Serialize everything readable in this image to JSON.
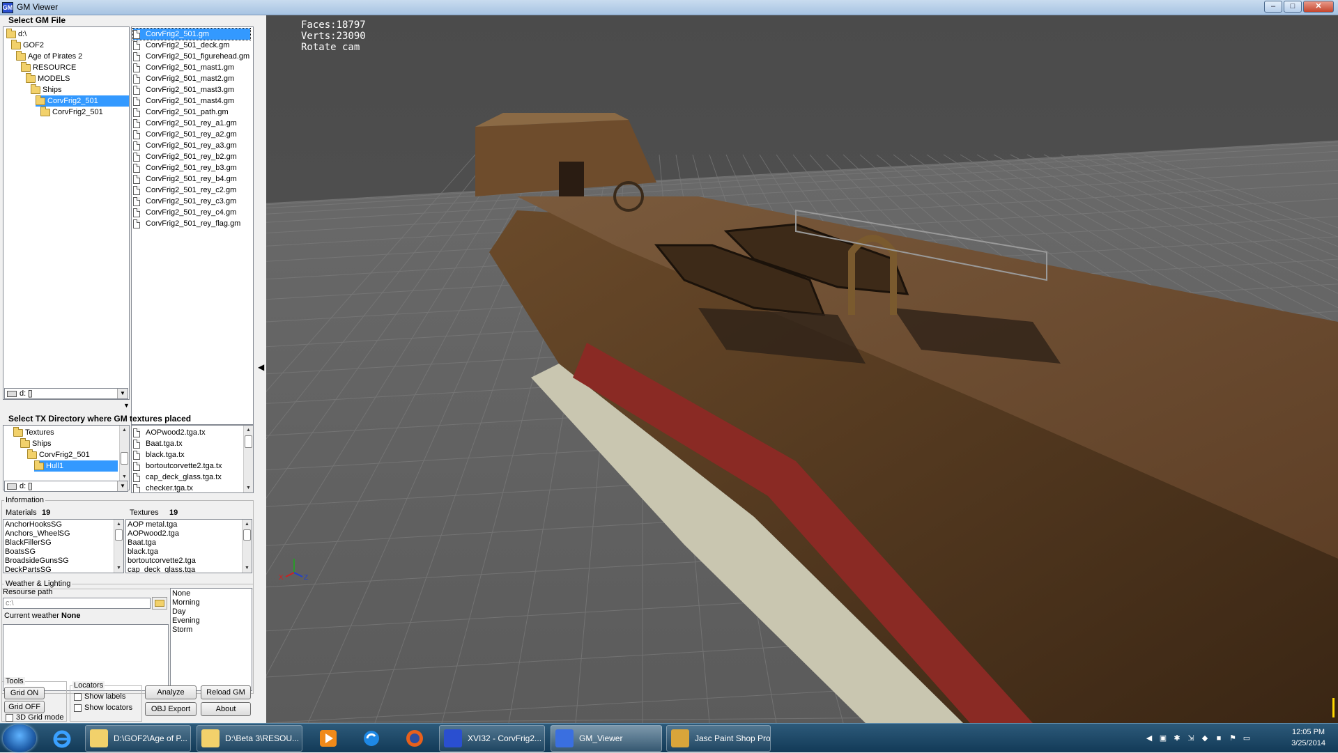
{
  "window": {
    "title": "GM Viewer"
  },
  "gm_section": {
    "label": "Select GM File",
    "tree": [
      {
        "label": "d:\\",
        "indent": 0,
        "selected": false
      },
      {
        "label": "GOF2",
        "indent": 1,
        "selected": false
      },
      {
        "label": "Age of Pirates 2",
        "indent": 2,
        "selected": false
      },
      {
        "label": "RESOURCE",
        "indent": 3,
        "selected": false
      },
      {
        "label": "MODELS",
        "indent": 4,
        "selected": false
      },
      {
        "label": "Ships",
        "indent": 5,
        "selected": false
      },
      {
        "label": "CorvFrig2_501",
        "indent": 6,
        "selected": true
      },
      {
        "label": "CorvFrig2_501",
        "indent": 7,
        "selected": false
      }
    ],
    "drive_combo": "d: []",
    "files": [
      "CorvFrig2_501.gm",
      "CorvFrig2_501_deck.gm",
      "CorvFrig2_501_figurehead.gm",
      "CorvFrig2_501_mast1.gm",
      "CorvFrig2_501_mast2.gm",
      "CorvFrig2_501_mast3.gm",
      "CorvFrig2_501_mast4.gm",
      "CorvFrig2_501_path.gm",
      "CorvFrig2_501_rey_a1.gm",
      "CorvFrig2_501_rey_a2.gm",
      "CorvFrig2_501_rey_a3.gm",
      "CorvFrig2_501_rey_b2.gm",
      "CorvFrig2_501_rey_b3.gm",
      "CorvFrig2_501_rey_b4.gm",
      "CorvFrig2_501_rey_c2.gm",
      "CorvFrig2_501_rey_c3.gm",
      "CorvFrig2_501_rey_c4.gm",
      "CorvFrig2_501_rey_flag.gm"
    ],
    "selected_file": 0
  },
  "tx_section": {
    "label": "Select TX Directory where GM textures placed",
    "tree": [
      {
        "label": "Textures",
        "indent": 1,
        "selected": false
      },
      {
        "label": "Ships",
        "indent": 2,
        "selected": false
      },
      {
        "label": "CorvFrig2_501",
        "indent": 3,
        "selected": false
      },
      {
        "label": "Hull1",
        "indent": 4,
        "selected": true
      }
    ],
    "drive_combo": "d: []",
    "files": [
      "AOPwood2.tga.tx",
      "Baat.tga.tx",
      "black.tga.tx",
      "bortoutcorvette2.tga.tx",
      "cap_deck_glass.tga.tx",
      "checker.tga.tx"
    ]
  },
  "info": {
    "label": "Information",
    "materials_label": "Materials",
    "materials_count": "19",
    "textures_label": "Textures",
    "textures_count": "19",
    "materials": [
      "AnchorHooksSG",
      "Anchors_WheelSG",
      "BlackFillerSG",
      "BoatsSG",
      "BroadsideGunsSG",
      "DeckPartsSG"
    ],
    "textures": [
      "AOP metal.tga",
      "AOPwood2.tga",
      "Baat.tga",
      "black.tga",
      "bortoutcorvette2.tga",
      "cap_deck_glass.tga"
    ]
  },
  "weather": {
    "label": "Weather & Lighting",
    "resource_path_label": "Resourse path",
    "resource_path_value": "c:\\",
    "current_weather_label": "Current weather :",
    "current_weather_value": "None",
    "options": [
      "None",
      "Morning",
      "Day",
      "Evening",
      "Storm"
    ]
  },
  "tools": {
    "label": "Tools",
    "grid_on": "Grid ON",
    "grid_off": "Grid OFF",
    "grid3d": "3D Grid mode",
    "locators_label": "Locators",
    "show_labels": "Show labels",
    "show_locators": "Show locators",
    "analyze": "Analyze",
    "reload": "Reload GM",
    "obj_export": "OBJ Export",
    "about": "About"
  },
  "viewport": {
    "faces": "Faces:18797",
    "verts": "Verts:23090",
    "mode": "Rotate cam",
    "axis_x": "X",
    "axis_z": "Z"
  },
  "taskbar": {
    "tasks": [
      {
        "label": "D:\\GOF2\\Age of P...",
        "icon": "folder-icon",
        "active": false
      },
      {
        "label": "D:\\Beta 3\\RESOU...",
        "icon": "folder-icon",
        "active": false
      },
      {
        "label": "XVI32 - CorvFrig2...",
        "icon": "hex-editor-icon",
        "active": false
      },
      {
        "label": "GM_Viewer",
        "icon": "gm-viewer-icon",
        "active": true
      },
      {
        "label": "Jasc Paint Shop Pro",
        "icon": "paint-icon",
        "active": false
      }
    ],
    "time": "12:05 PM",
    "date": "3/25/2014"
  },
  "colors": {
    "selection": "#3399ff",
    "viewport_bg": "#4a4a4a",
    "taskbar": "#1d4868"
  }
}
